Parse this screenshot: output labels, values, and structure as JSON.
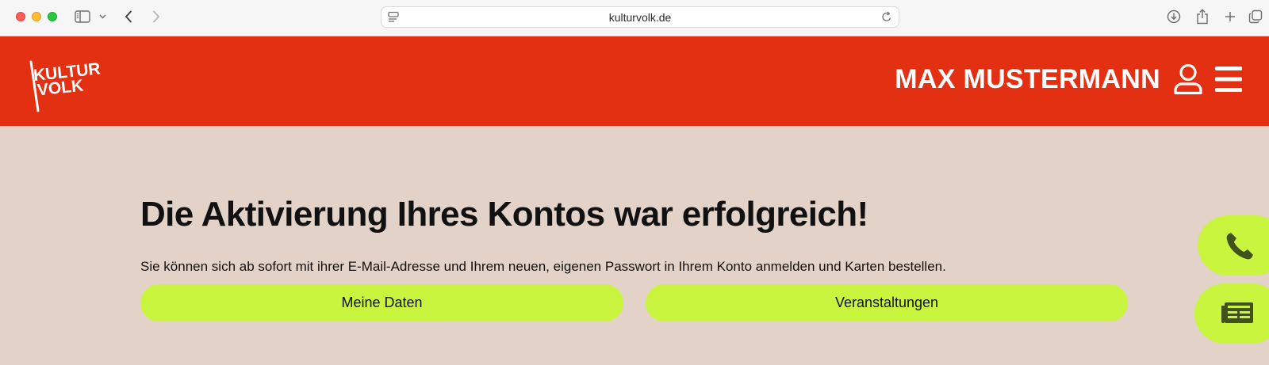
{
  "browser": {
    "url": "kulturvolk.de",
    "icons": [
      "close-button",
      "minimize-button",
      "zoom-button",
      "sidebar-icon",
      "chevron-down-icon",
      "back-icon",
      "forward-icon",
      "page-menu-icon",
      "reload-icon",
      "download-icon",
      "share-icon",
      "new-tab-icon",
      "tabs-overview-icon"
    ]
  },
  "header": {
    "logo_line1": "KULTUR",
    "logo_line2": "VOLK",
    "user_name": "MAX MUSTERMANN",
    "icons": [
      "user-icon",
      "menu-icon"
    ]
  },
  "main": {
    "headline": "Die Aktivierung Ihres Kontos war erfolgreich!",
    "subtext": "Sie können sich ab sofort mit ihrer E-Mail-Adresse und Ihrem neuen, eigenen Passwort in Ihrem Konto anmelden und Karten bestellen.",
    "buttons": [
      {
        "label": "Meine Daten"
      },
      {
        "label": "Veranstaltungen"
      }
    ]
  },
  "side_tabs": {
    "icons": [
      "phone-icon",
      "newspaper-icon"
    ]
  },
  "colors": {
    "brand_red": "#e43012",
    "accent_lime": "#c9f53f",
    "background": "#e2d2c7",
    "text": "#111111"
  }
}
